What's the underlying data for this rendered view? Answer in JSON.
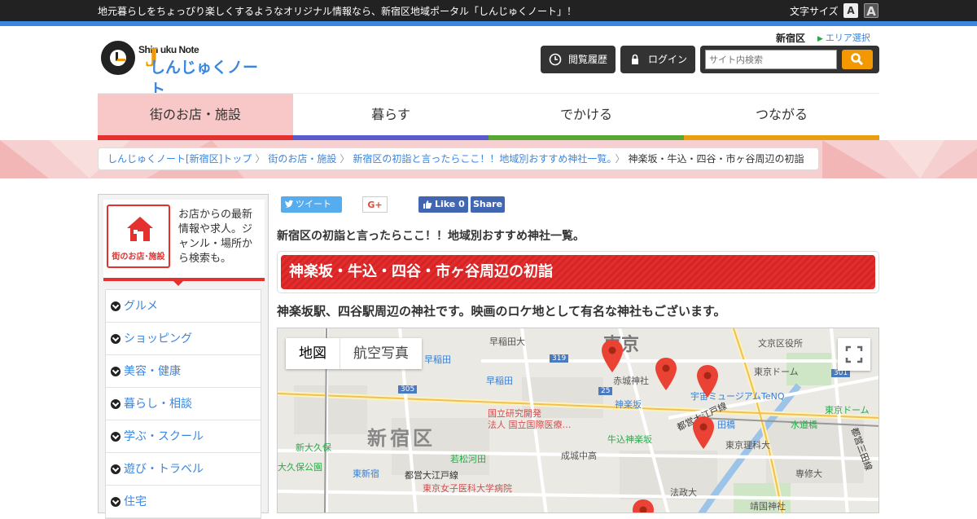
{
  "topbar": {
    "tagline": "地元暮らしをちょっぴり楽しくするようなオリジナル情報なら、新宿区地域ポータル「しんじゅくノート」！",
    "font_size_label": "文字サイズ",
    "font_small": "A",
    "font_large": "A"
  },
  "logo": {
    "en": "Shin uku Note",
    "ja": "しんじゅくノート",
    "j": "J"
  },
  "header": {
    "area_name": "新宿区",
    "area_select": "エリア選択",
    "history_button": "閲覧履歴",
    "login_button": "ログイン",
    "search_placeholder": "サイト内検索"
  },
  "nav": {
    "items": [
      {
        "label": "街のお店・施設",
        "color": "#e53030"
      },
      {
        "label": "暮らす",
        "color": "#5a5acc"
      },
      {
        "label": "でかける",
        "color": "#55a632"
      },
      {
        "label": "つながる",
        "color": "#e8a010"
      }
    ]
  },
  "breadcrumb": {
    "items": [
      "しんじゅくノート[新宿区]トップ",
      "街のお店・施設",
      "新宿区の初詣と言ったらここ！！地域別おすすめ神社一覧。"
    ],
    "current": "神楽坂・牛込・四谷・市ヶ谷周辺の初詣"
  },
  "sidebar": {
    "logo_caption": "街のお店･施設",
    "description": "お店からの最新情報や求人。ジャンル・場所から検索も。",
    "items": [
      "グルメ",
      "ショッピング",
      "美容・健康",
      "暮らし・相談",
      "学ぶ・スクール",
      "遊び・トラベル",
      "住宅"
    ]
  },
  "share": {
    "tweet": "ツイート",
    "gplus": "G+",
    "like": "Like 0",
    "fb_share": "Share"
  },
  "article": {
    "title": "新宿区の初詣と言ったらここ！！地域別おすすめ神社一覧。",
    "headline": "神楽坂・牛込・四谷・市ヶ谷周辺の初詣",
    "lead": "神楽坂駅、四谷駅周辺の神社です。映画のロケ地として有名な神社もございます。"
  },
  "map": {
    "tab_map": "地図",
    "tab_satellite": "航空写真",
    "labels": {
      "waseda_univ": "早稲田大",
      "tokyo": "東京",
      "bunkyo_office": "文京区役所",
      "waseda1": "早稲田",
      "waseda_sta": "早稲田",
      "akagi": "赤城神社",
      "kagurazaka": "神楽坂",
      "tokyodome": "東京ドーム",
      "space_museum": "宇宙ミュージアムTeNQ",
      "tokyodome2": "東京ドーム",
      "research": "国立研究開発",
      "research2": "法人 国立国際医療…",
      "oedo": "都営大江戸線",
      "iidabashi": "田橋",
      "suidobashi": "水道橋",
      "ushigome": "牛込神楽坂",
      "shinjuku_ku": "新宿区",
      "tus": "東京理科大",
      "shinokubo": "新大久保",
      "wakamatsu": "若松河田",
      "seijo": "成城中高",
      "okubo": "大久保公園",
      "higashi_shinjuku": "東新宿",
      "oedo2": "都営大江戸線",
      "twmu": "東京女子医科大学病院",
      "senshu": "専修大",
      "hosei": "法政大",
      "yasukuni": "靖国神社",
      "mita": "都営三田線",
      "r319": "319",
      "r305": "305",
      "r25": "25",
      "r301": "301"
    }
  }
}
